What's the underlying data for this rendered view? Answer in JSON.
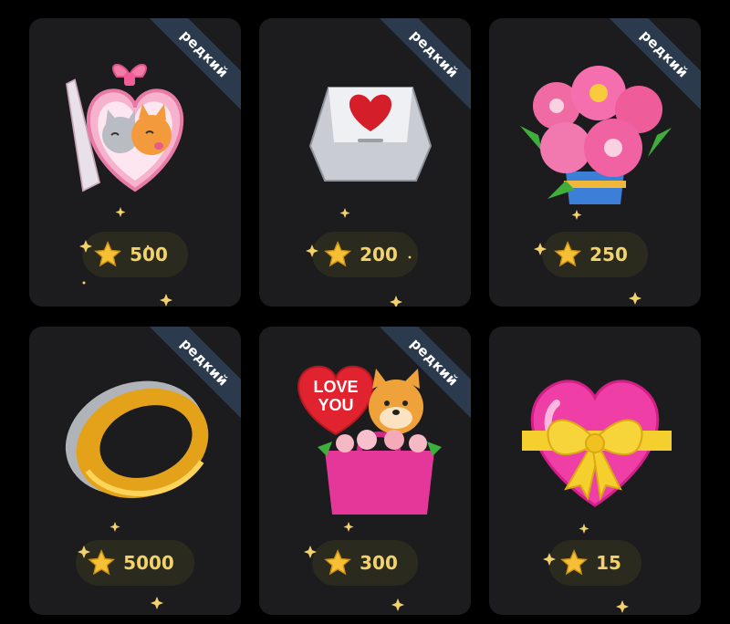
{
  "rare_label": "редкий",
  "gifts": [
    {
      "name": "kitten-heart-locket",
      "icon": "kitten-heart-icon",
      "rare": true,
      "price": "500"
    },
    {
      "name": "heart-key",
      "icon": "heart-key-icon",
      "rare": true,
      "price": "200"
    },
    {
      "name": "peony-bouquet",
      "icon": "bouquet-icon",
      "rare": true,
      "price": "250"
    },
    {
      "name": "gold-ring",
      "icon": "ring-icon",
      "rare": true,
      "price": "5000"
    },
    {
      "name": "love-you-dog-bag",
      "icon": "love-you-dog-icon",
      "rare": true,
      "price": "300",
      "balloon_text_1": "LOVE",
      "balloon_text_2": "YOU"
    },
    {
      "name": "bow-heart",
      "icon": "bow-heart-icon",
      "rare": false,
      "price": "15"
    }
  ],
  "colors": {
    "background": "#000000",
    "card": "#1c1c1e",
    "ribbon": "#2b3a4c",
    "price_pill": "#2a2a1f",
    "star": "#f5c035",
    "price_text": "#f4d26b"
  }
}
